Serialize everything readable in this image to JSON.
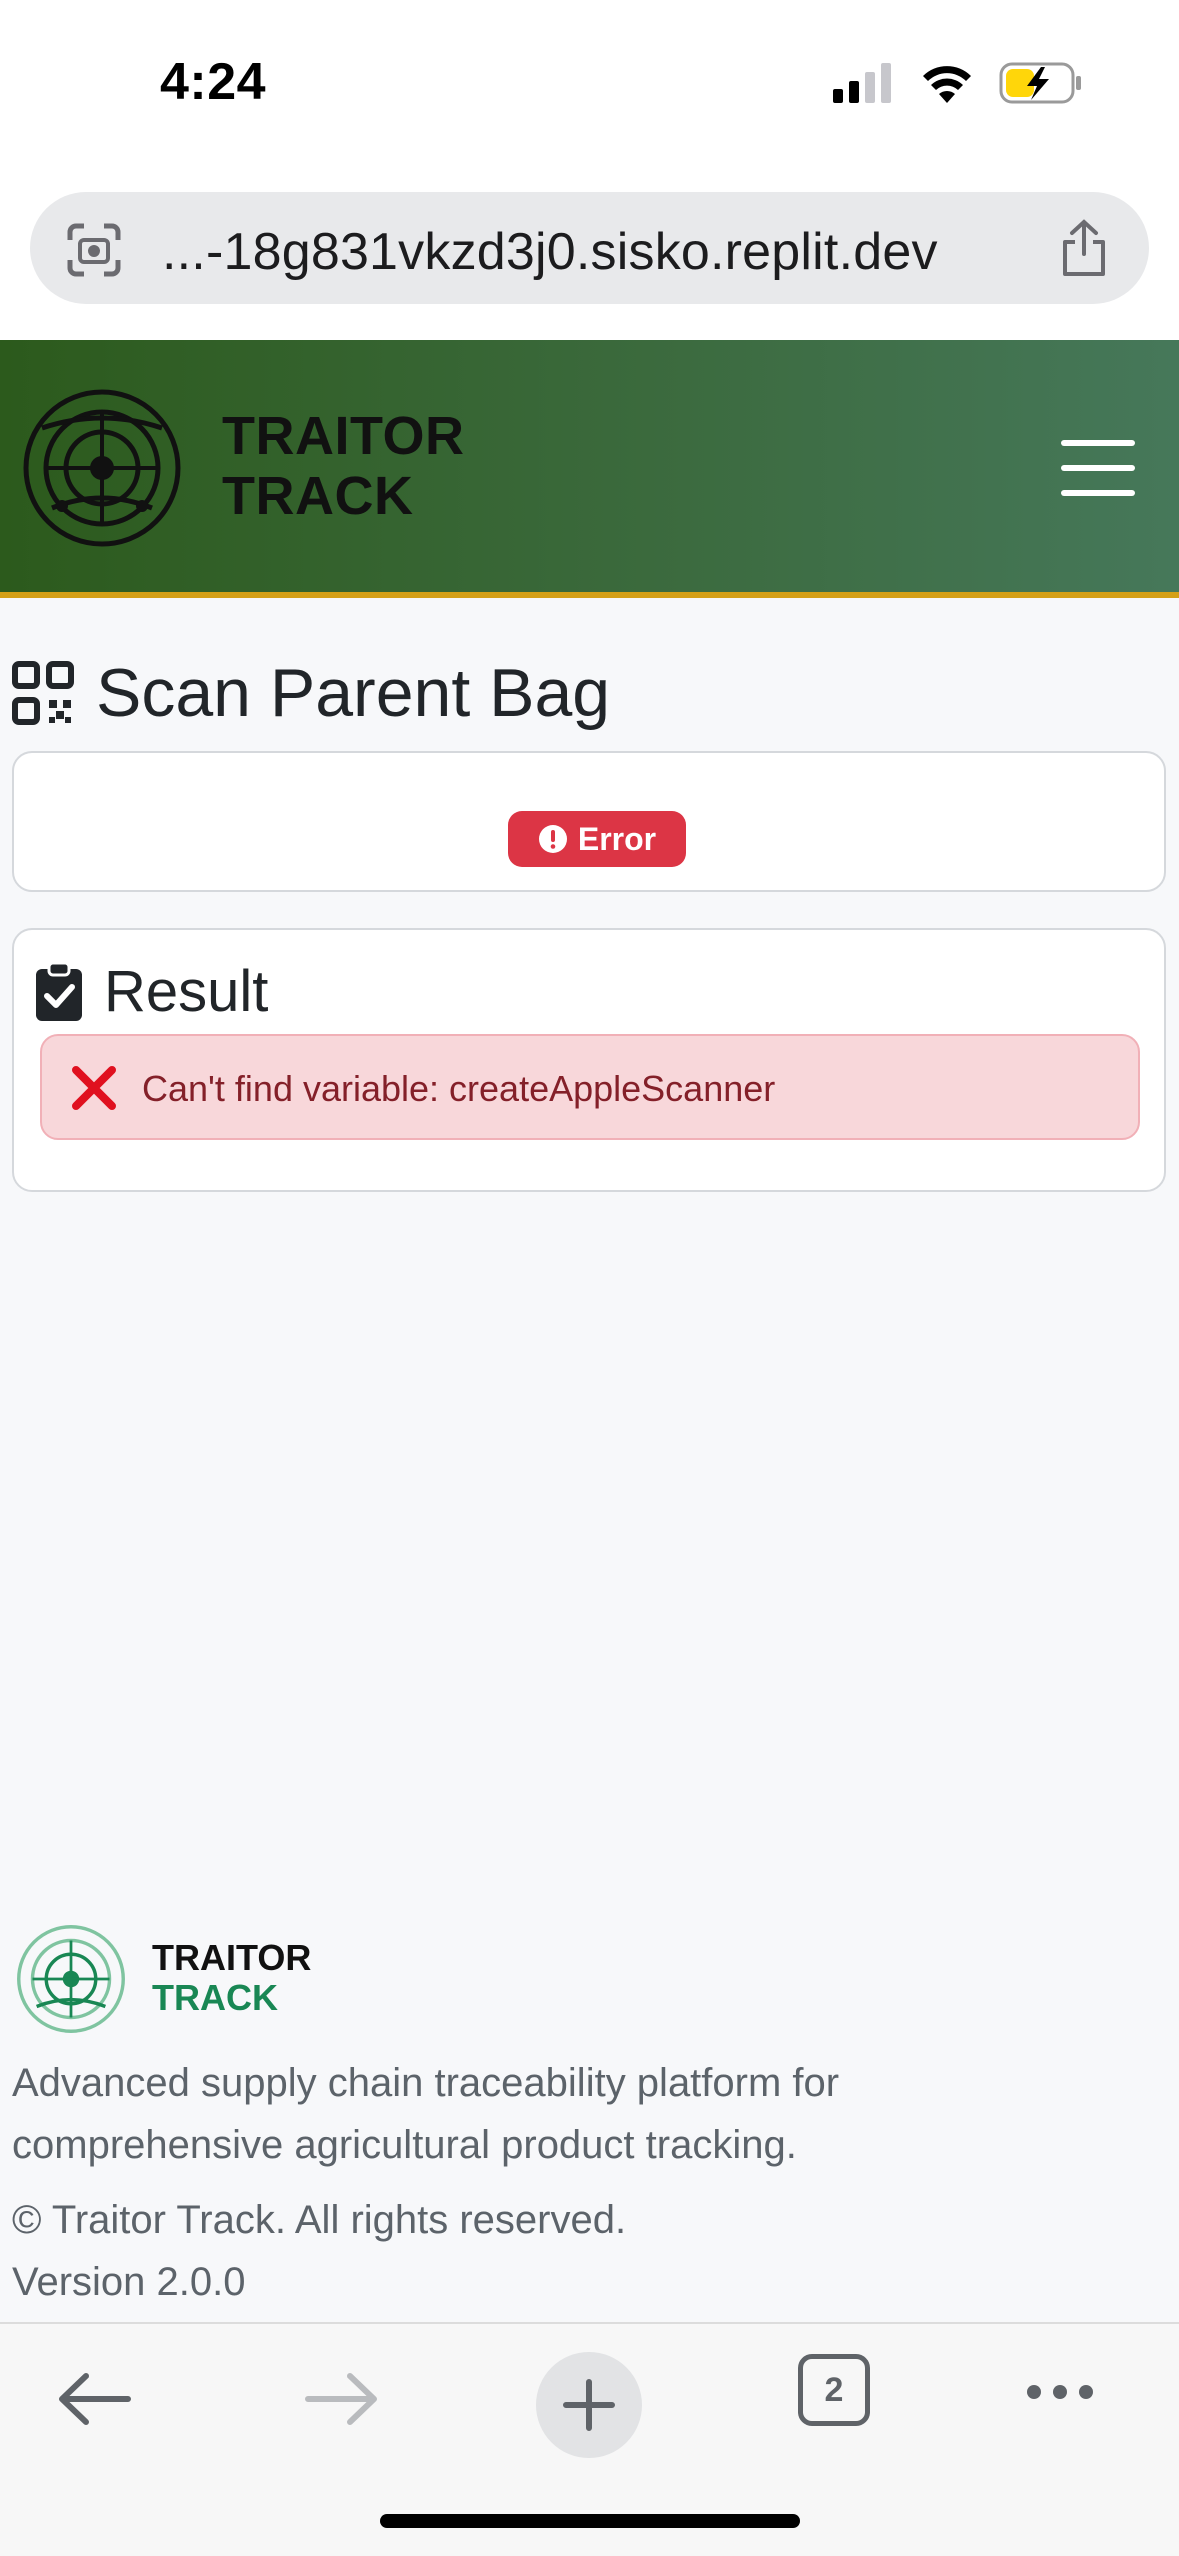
{
  "status_bar": {
    "time": "4:24"
  },
  "browser": {
    "url": "...-18g831vkzd3j0.sisko.replit.dev",
    "tab_count": "2"
  },
  "header": {
    "brand_line1": "TRAITOR",
    "brand_line2": "TRACK",
    "colors": {
      "gradient_start": "#2c5a1c",
      "gradient_end": "#46785a",
      "accent_border": "#d4a017"
    }
  },
  "page": {
    "title": "Scan Parent Bag",
    "status_badge": "Error",
    "result_heading": "Result",
    "error_message": "Can't find variable: createAppleScanner",
    "colors": {
      "error": "#dc3545",
      "alert_bg": "#f8d7da"
    }
  },
  "footer": {
    "brand_line1": "TRAITOR",
    "brand_line2": "TRACK",
    "description": "Advanced supply chain traceability platform for comprehensive agricultural product tracking.",
    "copyright": "© Traitor Track. All rights reserved.",
    "version": "Version 2.0.0"
  },
  "icons": [
    "signal-icon",
    "wifi-icon",
    "battery-icon",
    "scan-icon",
    "share-icon",
    "logo-icon",
    "menu-icon",
    "qr-code-icon",
    "alert-icon",
    "clipboard-check-icon",
    "x-icon",
    "back-icon",
    "forward-icon",
    "plus-icon",
    "tabs-icon",
    "more-icon"
  ]
}
